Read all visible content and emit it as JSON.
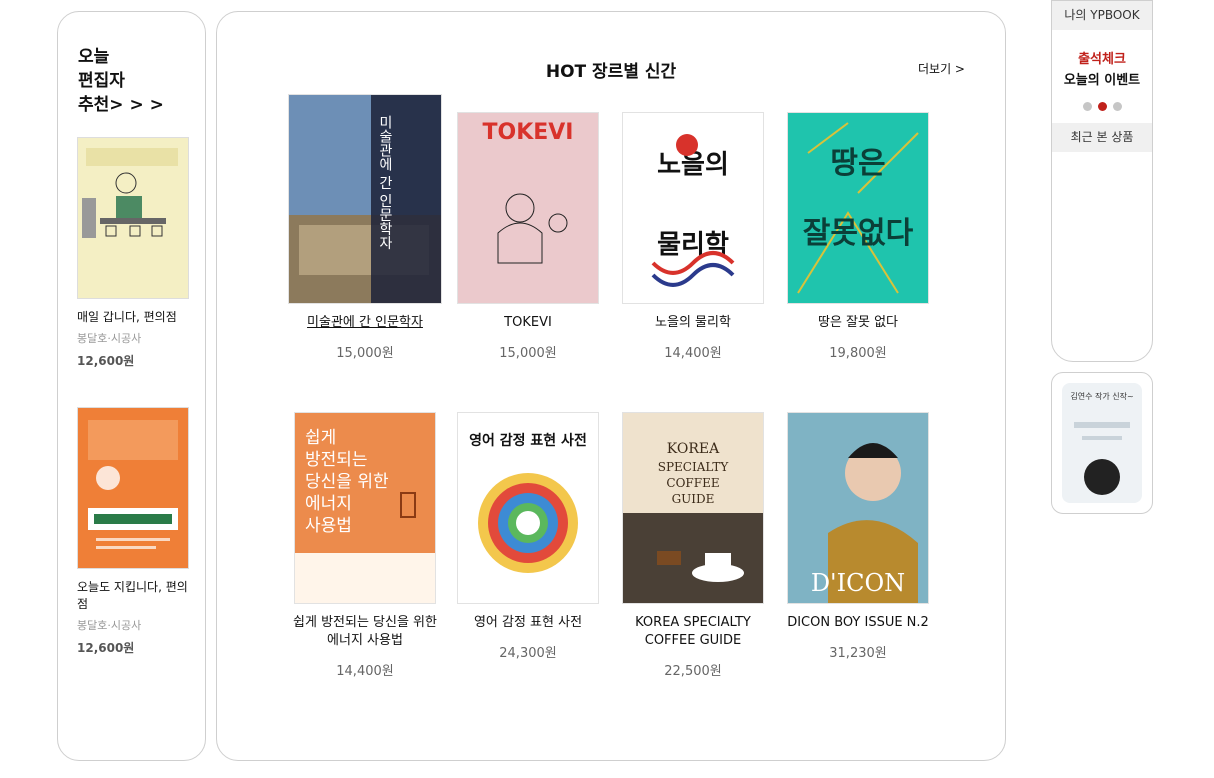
{
  "left_pick": {
    "title": "오늘\n편집자\n추천> > >",
    "books": [
      {
        "title": "매일 갑니다, 편의점",
        "author": "봉달호·시공사",
        "price": "12,600원"
      },
      {
        "title": "오늘도 지킵니다, 편의점",
        "author": "봉달호·시공사",
        "price": "12,600원"
      }
    ]
  },
  "hot": {
    "title": "HOT 장르별 신간",
    "more": "더보기 >",
    "books": [
      {
        "title": "미술관에 간 인문학자",
        "price": "15,000원",
        "cover_text": "미술관에 간 인문학자"
      },
      {
        "title": "TOKEVI",
        "price": "15,000원",
        "cover_text": "TOKEVI"
      },
      {
        "title": "노을의 물리학",
        "price": "14,400원",
        "cover_text": "노을의 물리학"
      },
      {
        "title": "땅은 잘못 없다",
        "price": "19,800원",
        "cover_text": "땅은 잘못 없다"
      },
      {
        "title": "쉽게 방전되는 당신을 위한 에너지 사용법",
        "price": "14,400원",
        "cover_text": "쉽게 방전되는 당신을 위한 에너지 사용법"
      },
      {
        "title": "영어 감정 표현 사전",
        "price": "24,300원",
        "cover_text": "영어 감정 표현 사전"
      },
      {
        "title": "KOREA SPECIALTY COFFEE GUIDE",
        "price": "22,500원",
        "cover_text": "KOREA SPECIALTY COFFEE GUIDE"
      },
      {
        "title": "DICON BOY ISSUE N.2",
        "price": "31,230원",
        "cover_text": "D'ICON"
      }
    ]
  },
  "right_panel": {
    "my_ypbook": "나의 YPBOOK",
    "event_line1": "출석체크",
    "event_line2": "오늘의 이벤트",
    "recent": "최근 본 상품"
  },
  "ad": {
    "text": "김연수 작가 신작~"
  },
  "colors": {
    "accent": "#c0211b",
    "border": "#cfcfcf"
  }
}
